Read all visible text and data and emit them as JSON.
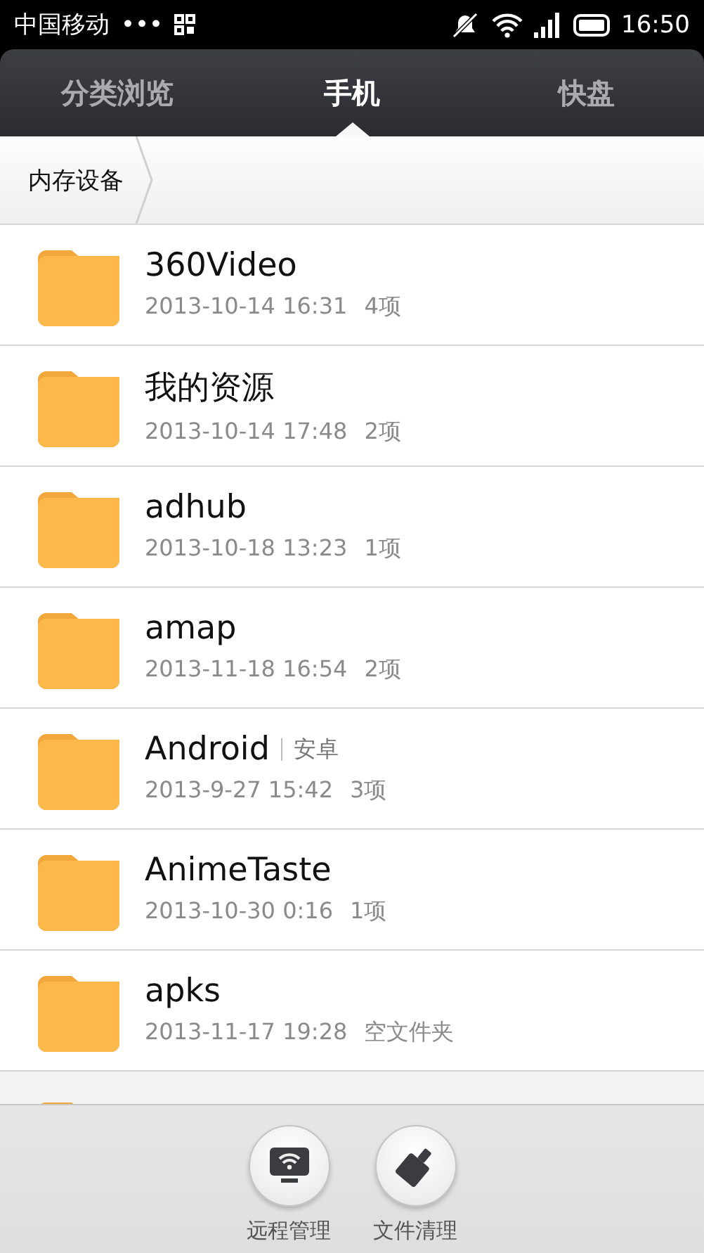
{
  "status_bar": {
    "carrier": "中国移动",
    "dots": "•••",
    "time": "16:50"
  },
  "tabs": [
    {
      "label": "分类浏览",
      "selected": false
    },
    {
      "label": "手机",
      "selected": true
    },
    {
      "label": "快盘",
      "selected": false
    }
  ],
  "breadcrumb": [
    "内存设备"
  ],
  "files": [
    {
      "name": "360Video",
      "date": "2013-10-14 16:31",
      "count": "4项"
    },
    {
      "name": "我的资源",
      "date": "2013-10-14 17:48",
      "count": "2项"
    },
    {
      "name": "adhub",
      "date": "2013-10-18 13:23",
      "count": "1项"
    },
    {
      "name": "amap",
      "date": "2013-11-18 16:54",
      "count": "2项"
    },
    {
      "name": "Android",
      "alias": "安卓",
      "date": "2013-9-27 15:42",
      "count": "3项"
    },
    {
      "name": "AnimeTaste",
      "date": "2013-10-30 0:16",
      "count": "1项"
    },
    {
      "name": "apks",
      "date": "2013-11-17 19:28",
      "count": "空文件夹"
    }
  ],
  "actions": [
    {
      "kind": "remote",
      "label": "远程管理"
    },
    {
      "kind": "clean",
      "label": "文件清理"
    }
  ]
}
